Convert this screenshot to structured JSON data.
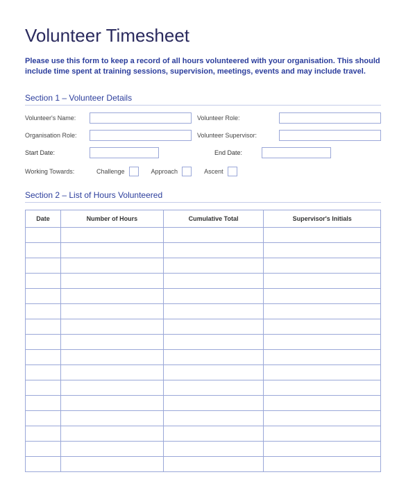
{
  "title": "Volunteer Timesheet",
  "intro": "Please use this form to keep a record of all hours volunteered with your organisation. This should include time spent at training sessions, supervision, meetings, events and may include travel.",
  "section1": {
    "heading": "Section 1 – Volunteer Details",
    "labels": {
      "name": "Volunteer's Name:",
      "role": "Volunteer Role:",
      "org_role": "Organisation Role:",
      "supervisor": "Volunteer Supervisor:",
      "start_date": "Start Date:",
      "end_date": "End Date:",
      "working_towards": "Working Towards:",
      "challenge": "Challenge",
      "approach": "Approach",
      "ascent": "Ascent"
    },
    "values": {
      "name": "",
      "role": "",
      "org_role": "",
      "supervisor": "",
      "start_date": "",
      "end_date": "",
      "challenge": false,
      "approach": false,
      "ascent": false
    }
  },
  "section2": {
    "heading": "Section 2 – List of Hours Volunteered",
    "columns": [
      "Date",
      "Number of Hours",
      "Cumulative Total",
      "Supervisor's Initials"
    ],
    "row_count": 16
  }
}
